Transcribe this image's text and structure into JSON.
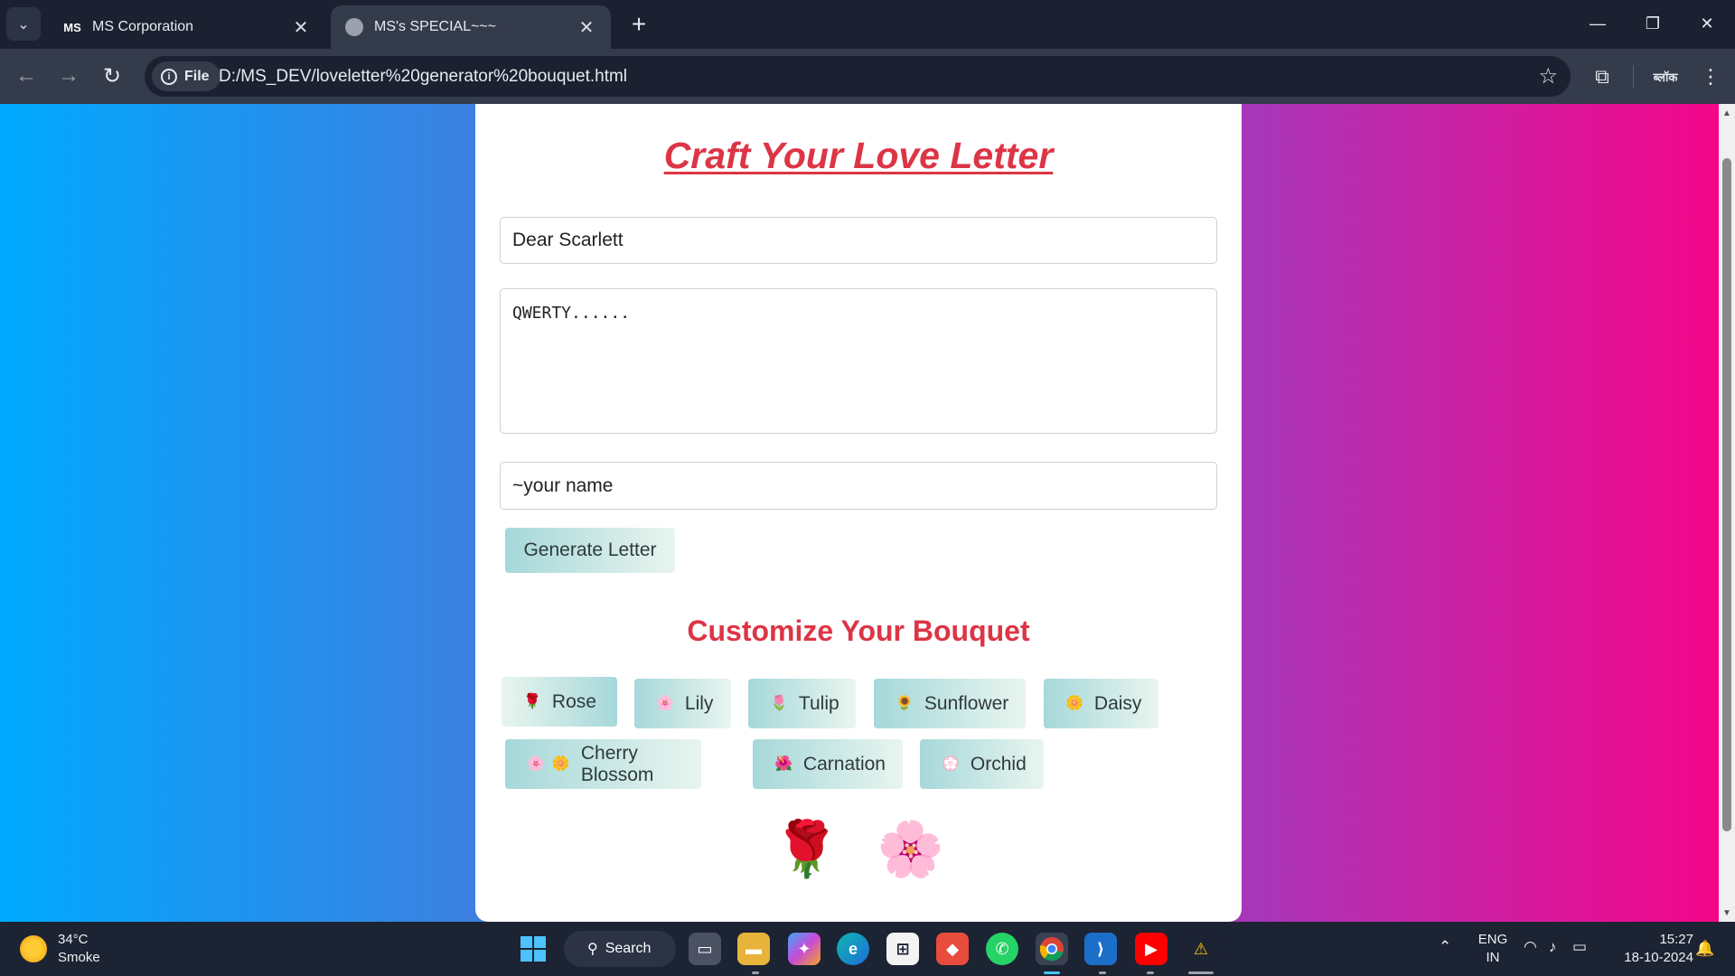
{
  "browser": {
    "tabs": [
      {
        "title": "MS Corporation",
        "favicon_text": "MS"
      },
      {
        "title": "MS's SPECIAL~~~"
      }
    ],
    "url_chip": "File",
    "url": "D:/MS_DEV/loveletter%20generator%20bouquet.html",
    "extension_label": "ब्लॉक"
  },
  "page": {
    "title": "Craft Your Love Letter",
    "greeting_value": "Dear Scarlett",
    "message_value": "QWERTY......",
    "signature_value": "~your name",
    "generate_label": "Generate Letter",
    "bouquet_title": "Customize Your Bouquet",
    "flowers": [
      {
        "label": "Rose",
        "emoji": "🌹"
      },
      {
        "label": "Lily",
        "emoji": "🌸"
      },
      {
        "label": "Tulip",
        "emoji": "🌷"
      },
      {
        "label": "Sunflower",
        "emoji": "🌻"
      },
      {
        "label": "Daisy",
        "emoji": "🌼"
      },
      {
        "label": "Cherry Blossom",
        "emoji": "🌸",
        "emoji2": "🌼"
      },
      {
        "label": "Carnation",
        "emoji": "🌺"
      },
      {
        "label": "Orchid",
        "emoji": "💮"
      }
    ],
    "bouquet_items": [
      "🌹",
      "🌸"
    ]
  },
  "taskbar": {
    "weather_temp": "34°C",
    "weather_desc": "Smoke",
    "search_label": "Search",
    "lang_top": "ENG",
    "lang_bottom": "IN",
    "time": "15:27",
    "date": "18-10-2024"
  },
  "colors": {
    "accent_red": "#dc3545",
    "gradient_left": "#00aaff",
    "gradient_right": "#f5068a"
  }
}
